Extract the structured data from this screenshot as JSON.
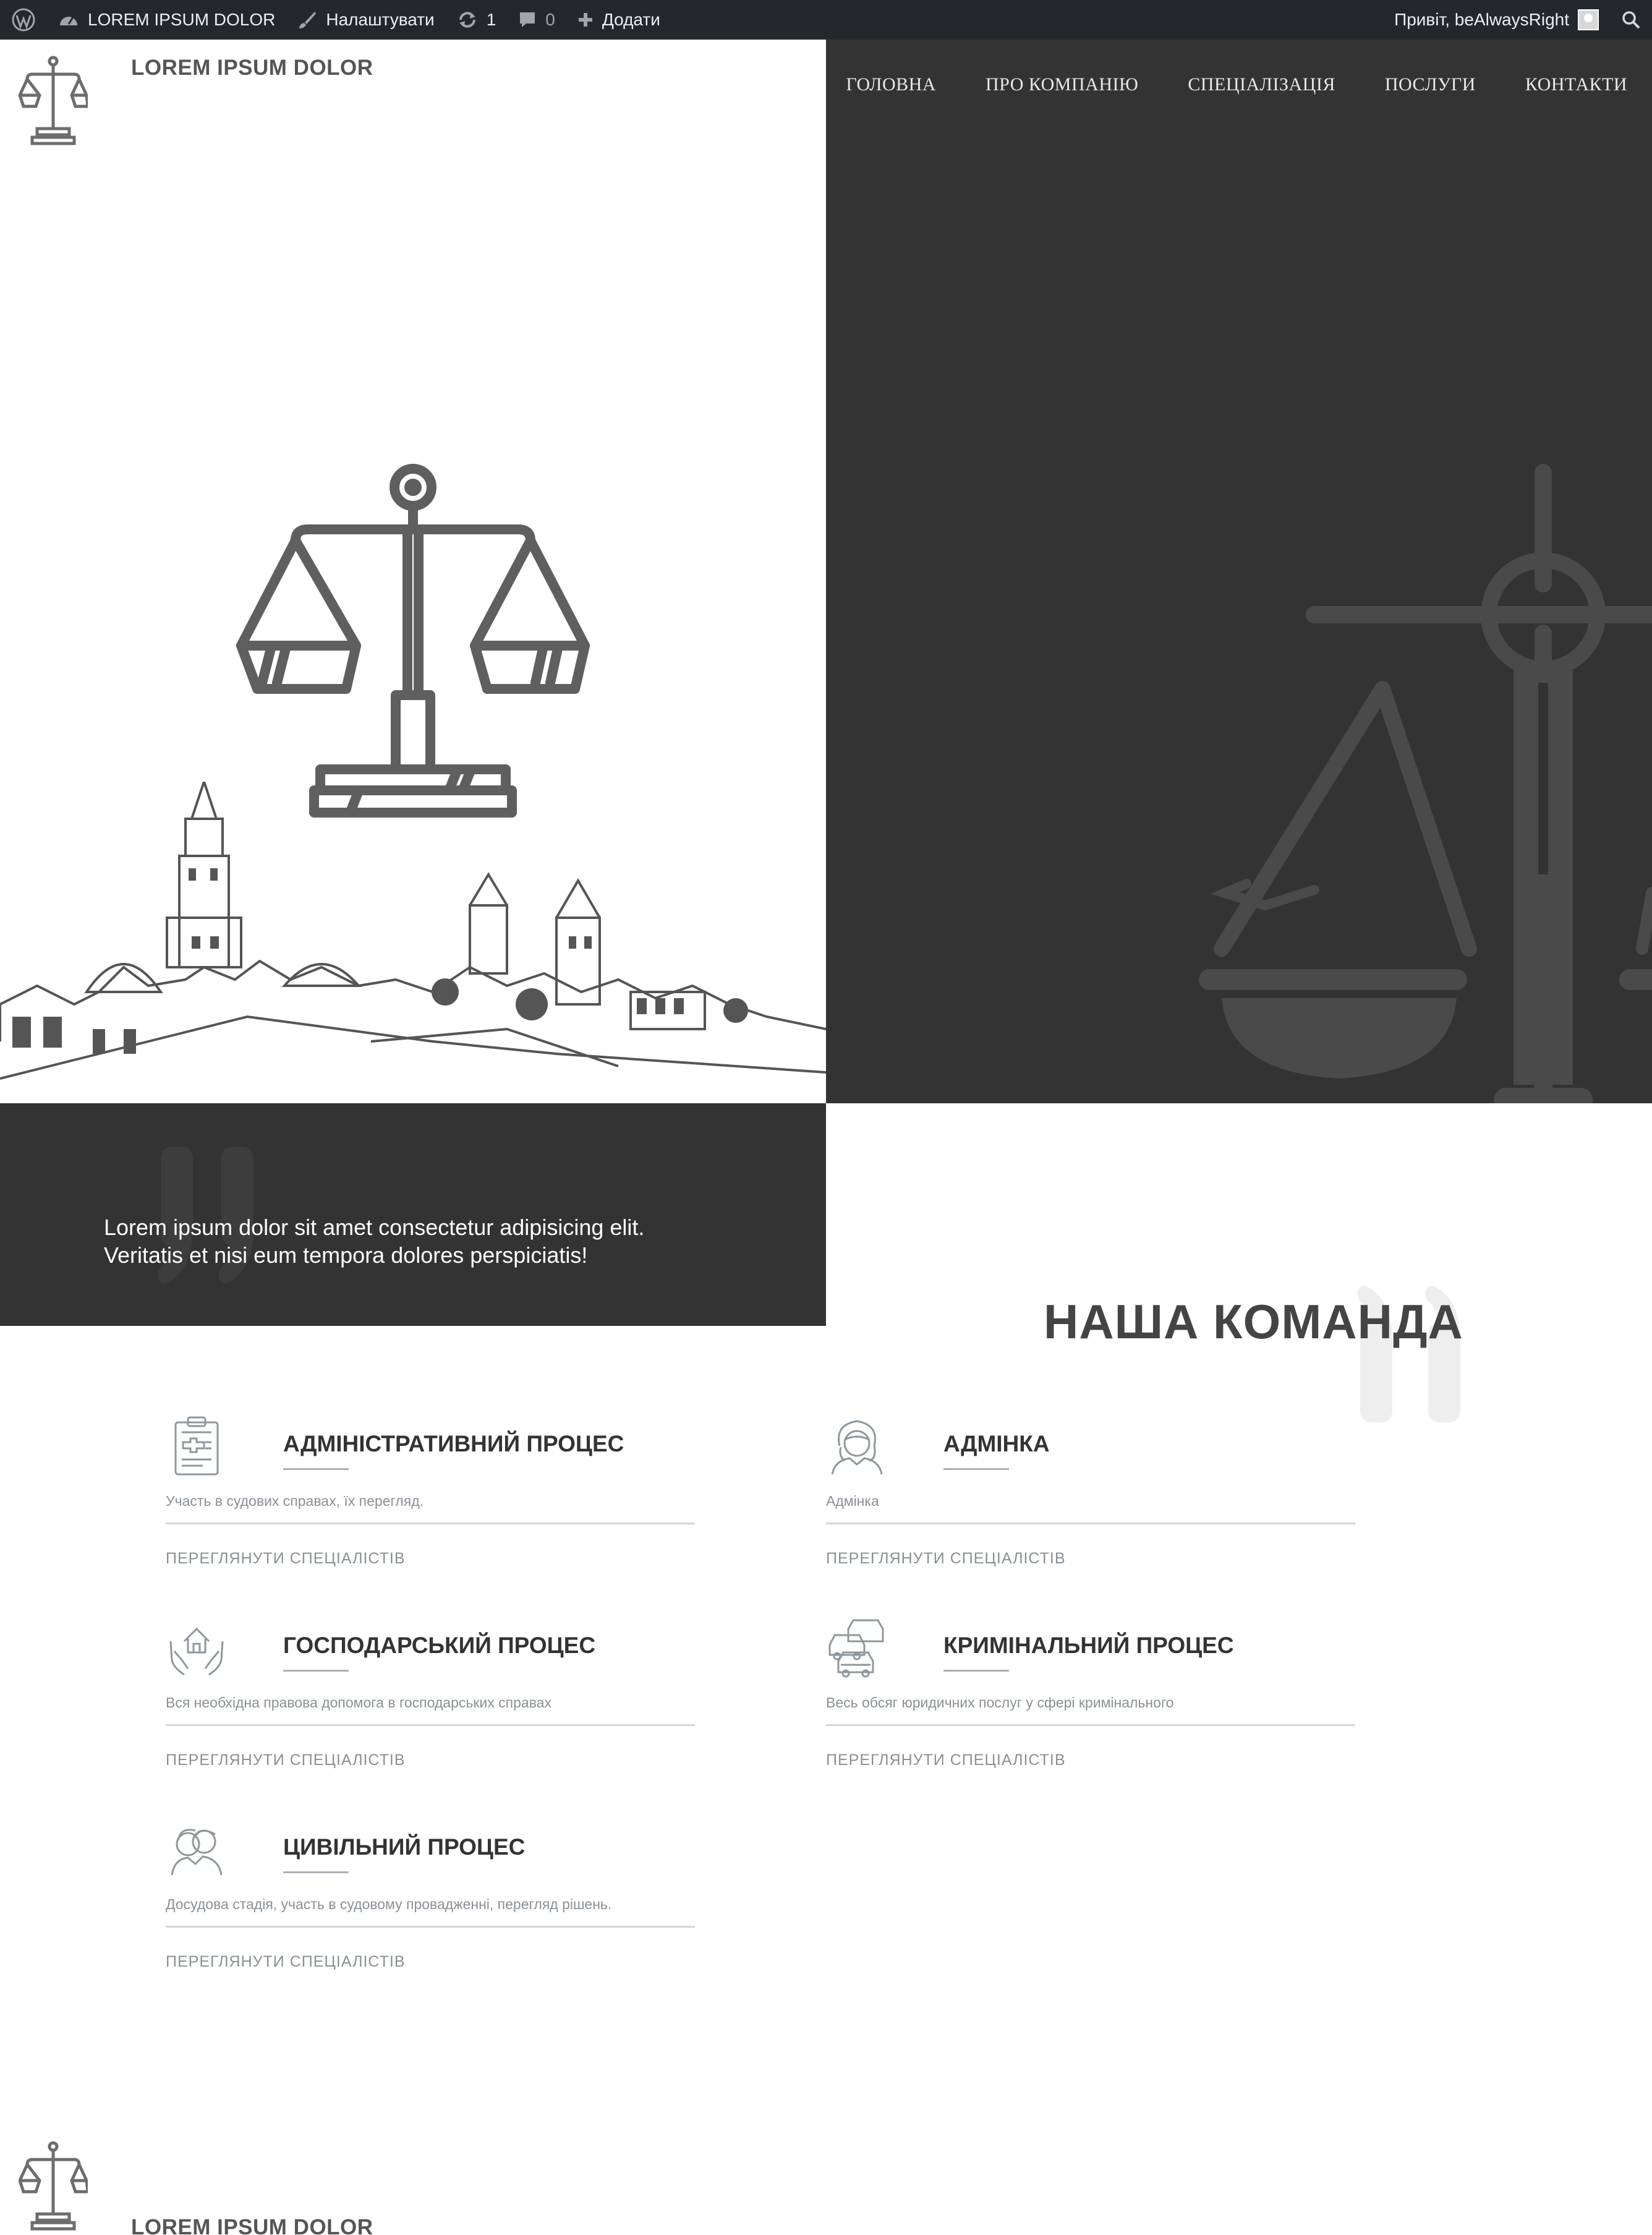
{
  "admin_bar": {
    "site_name": "LOREM IPSUM DOLOR",
    "customize_label": "Налаштувати",
    "updates_count": "1",
    "comments_count": "0",
    "new_label": "Додати",
    "greeting": "Привіт, beAlwaysRight"
  },
  "header": {
    "logo_text": "LOREM IPSUM DOLOR",
    "nav": [
      "ГОЛОВНА",
      "ПРО КОМПАНІЮ",
      "СПЕЦІАЛІЗАЦІЯ",
      "ПОСЛУГИ",
      "КОНТАКТИ"
    ]
  },
  "quote": {
    "line1": "Lorem ipsum dolor sit amet consectetur adipisicing elit.",
    "line2": "Veritatis et nisi eum tempora dolores perspiciatis!"
  },
  "team": {
    "title": "НАША КОМАНДА"
  },
  "services": [
    {
      "title": "АДМІНІСТРАТИВНИЙ ПРОЦЕС",
      "description": "Участь в судових справах, їх перегляд.",
      "link": "ПЕРЕГЛЯНУТИ СПЕЦІАЛІСТІВ",
      "icon": "clipboard-icon"
    },
    {
      "title": "АДМІНКА",
      "description": "Адмінка",
      "link": "ПЕРЕГЛЯНУТИ СПЕЦІАЛІСТІВ",
      "icon": "woman-avatar-icon"
    },
    {
      "title": "ГОСПОДАРСЬКИЙ ПРОЦЕС",
      "description": "Вся необхідна правова допомога в господарських справах",
      "link": "ПЕРЕГЛЯНУТИ СПЕЦІАЛІСТІВ",
      "icon": "house-hands-icon"
    },
    {
      "title": "КРИМІНАЛЬНИЙ ПРОЦЕС",
      "description": "Весь обсяг юридичних послуг у сфері кримінального",
      "link": "ПЕРЕГЛЯНУТИ СПЕЦІАЛІСТІВ",
      "icon": "cars-icon"
    },
    {
      "title": "ЦИВІЛЬНИЙ ПРОЦЕС",
      "description": "Досудова стадія, участь в судовому провадженні, перегляд рішень.",
      "link": "ПЕРЕГЛЯНУТИ СПЕЦІАЛІСТІВ",
      "icon": "people-icon"
    }
  ],
  "footer": {
    "logo_text": "LOREM IPSUM DOLOR"
  },
  "colors": {
    "admin_bar": "#23282d",
    "dark_panel": "#333333",
    "text_dark": "#333333",
    "text_muted": "#8a9096"
  }
}
